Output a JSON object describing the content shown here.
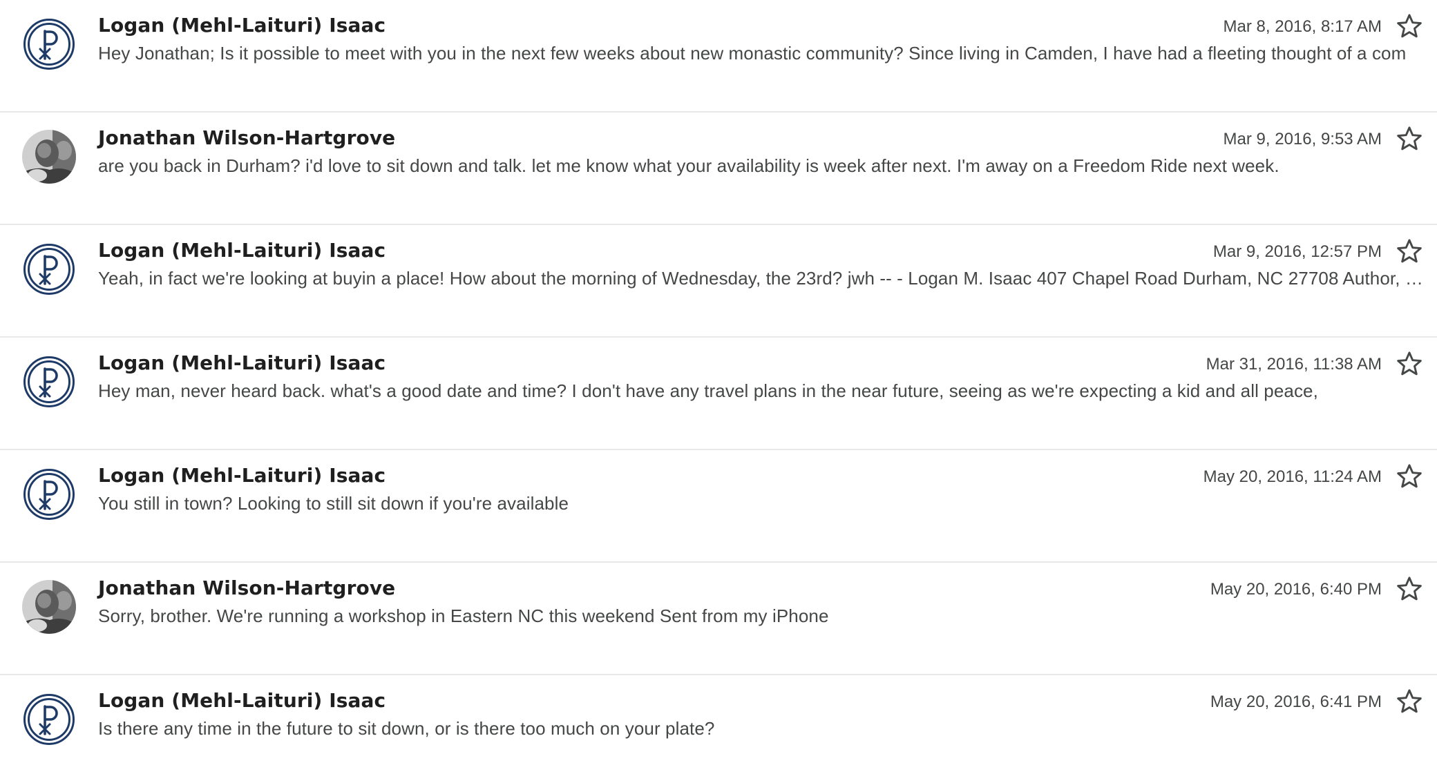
{
  "messages": [
    {
      "sender": "Logan (Mehl-Laituri) Isaac",
      "avatar": "logo",
      "date": "Mar 8, 2016, 8:17 AM",
      "snippet": "Hey Jonathan; Is it possible to meet with you in the next few weeks about new monastic community? Since living in Camden, I have had a fleeting thought of a com"
    },
    {
      "sender": "Jonathan Wilson-Hartgrove",
      "avatar": "photo",
      "date": "Mar 9, 2016, 9:53 AM",
      "snippet": "are you back in Durham? i'd love to sit down and talk. let me know what your availability is week after next. I'm away on a Freedom Ride next week."
    },
    {
      "sender": "Logan (Mehl-Laituri) Isaac",
      "avatar": "logo",
      "date": "Mar 9, 2016, 12:57 PM",
      "snippet": "Yeah, in fact we're looking at buyin a place! How about the morning of Wednesday, the 23rd? jwh -- - Logan M. Isaac 407 Chapel Road Durham, NC 27708 Author, …"
    },
    {
      "sender": "Logan (Mehl-Laituri) Isaac",
      "avatar": "logo",
      "date": "Mar 31, 2016, 11:38 AM",
      "snippet": "Hey man, never heard back. what's a good date and time? I don't have any travel plans in the near future, seeing as we're expecting a kid and all peace,"
    },
    {
      "sender": "Logan (Mehl-Laituri) Isaac",
      "avatar": "logo",
      "date": "May 20, 2016, 11:24 AM",
      "snippet": "You still in town? Looking to still sit down if you're available"
    },
    {
      "sender": "Jonathan Wilson-Hartgrove",
      "avatar": "photo",
      "date": "May 20, 2016, 6:40 PM",
      "snippet": "Sorry, brother. We're running a workshop in Eastern NC this weekend Sent from my iPhone"
    },
    {
      "sender": "Logan (Mehl-Laituri) Isaac",
      "avatar": "logo",
      "date": "May 20, 2016, 6:41 PM",
      "snippet": "Is there any time in the future to sit down, or is there too much on your plate?"
    }
  ],
  "icons": {
    "star": "star-outline-icon",
    "logo_avatar": "chi-rho-logo-icon",
    "photo_avatar": "profile-photo"
  },
  "colors": {
    "logo_navy": "#1e3a66",
    "divider": "#e8e8e8",
    "sender_text": "#1f1f1f",
    "body_text": "#444746"
  }
}
